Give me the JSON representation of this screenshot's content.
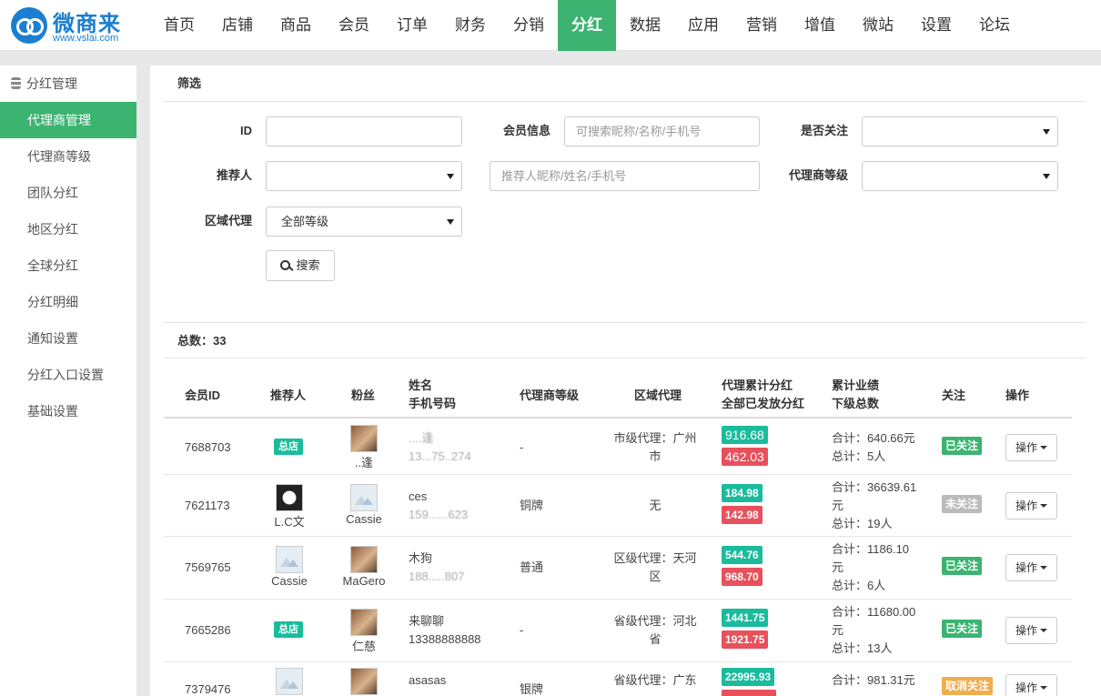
{
  "logo": {
    "name": "微商来",
    "url": "www.vslai.com"
  },
  "nav": [
    "首页",
    "店铺",
    "商品",
    "会员",
    "订单",
    "财务",
    "分销",
    "分红",
    "数据",
    "应用",
    "营销",
    "增值",
    "微站",
    "设置",
    "论坛"
  ],
  "sidebar": {
    "title": "分红管理",
    "items": [
      "代理商管理",
      "代理商等级",
      "团队分红",
      "地区分红",
      "全球分红",
      "分红明细",
      "通知设置",
      "分红入口设置",
      "基础设置"
    ]
  },
  "filter": {
    "title": "筛选",
    "id_label": "ID",
    "member_label": "会员信息",
    "member_placeholder": "可搜索昵称/名称/手机号",
    "follow_label": "是否关注",
    "referrer_label": "推荐人",
    "referrer_placeholder": "推荐人昵称/姓名/手机号",
    "agent_level_label": "代理商等级",
    "region_label": "区域代理",
    "region_value": "全部等级",
    "search_label": "搜索"
  },
  "summary": {
    "total_label": "总数：33"
  },
  "table": {
    "headers": {
      "member_id": "会员ID",
      "referrer": "推荐人",
      "fans": "粉丝",
      "name": "姓名",
      "phone": "手机号码",
      "agent_level": "代理商等级",
      "region": "区域代理",
      "cum_bonus": "代理累计分红",
      "paid_bonus": "全部已发放分红",
      "cum_perf": "累计业绩",
      "sub_total": "下级总数",
      "follow": "关注",
      "action": "操作"
    },
    "rows": [
      {
        "id": "7688703",
        "referrer_tag": "总店",
        "fan_name": "..逢",
        "name": "....逢",
        "phone": "13...75..274",
        "level": "-",
        "region_1": "市级代理：广州",
        "region_2": "市",
        "bonus": "916.68",
        "paid": "462.03",
        "perf_1": "合计：640.66元",
        "perf_2": "",
        "perf_3": "总计：5人",
        "follow": "已关注",
        "action": "操作"
      },
      {
        "id": "7621173",
        "referrer_name": "L.C文",
        "fan_name": "Cassie",
        "name": "ces",
        "phone": "159......623",
        "level": "铜牌",
        "region_1": "无",
        "region_2": "",
        "bonus": "184.98",
        "paid": "142.98",
        "perf_1": "合计：36639.61",
        "perf_2": "元",
        "perf_3": "总计：19人",
        "follow": "未关注",
        "action": "操作"
      },
      {
        "id": "7569765",
        "referrer_name": "Cassie",
        "fan_name": "MaGero",
        "name": "木狗",
        "phone": "188.....807",
        "level": "普通",
        "region_1": "区级代理：天河",
        "region_2": "区",
        "bonus": "544.76",
        "paid": "968.70",
        "perf_1": "合计：1186.10",
        "perf_2": "元",
        "perf_3": "总计：6人",
        "follow": "已关注",
        "action": "操作"
      },
      {
        "id": "7665286",
        "referrer_tag": "总店",
        "fan_name": "仁慈",
        "name": "来聊聊",
        "phone": "13388888888",
        "level": "-",
        "region_1": "省级代理：河北",
        "region_2": "省",
        "bonus": "1441.75",
        "paid": "1921.75",
        "perf_1": "合计：11680.00",
        "perf_2": "元",
        "perf_3": "总计：13人",
        "follow": "已关注",
        "action": "操作"
      },
      {
        "id": "7379476",
        "referrer_name": "",
        "fan_name": "",
        "name": "asasas",
        "phone": "",
        "level": "银牌",
        "region_1": "省级代理：广东",
        "region_2": "",
        "bonus": "22995.93",
        "paid": "",
        "perf_1": "合计：981.31元",
        "perf_2": "",
        "perf_3": "",
        "follow": "取消关注",
        "action": "操作"
      }
    ]
  },
  "colors": {
    "brand": "#1a7fd0",
    "accent": "#3cb371",
    "teal": "#1abc9c",
    "red": "#e8505b",
    "orange": "#f0ad4e"
  }
}
